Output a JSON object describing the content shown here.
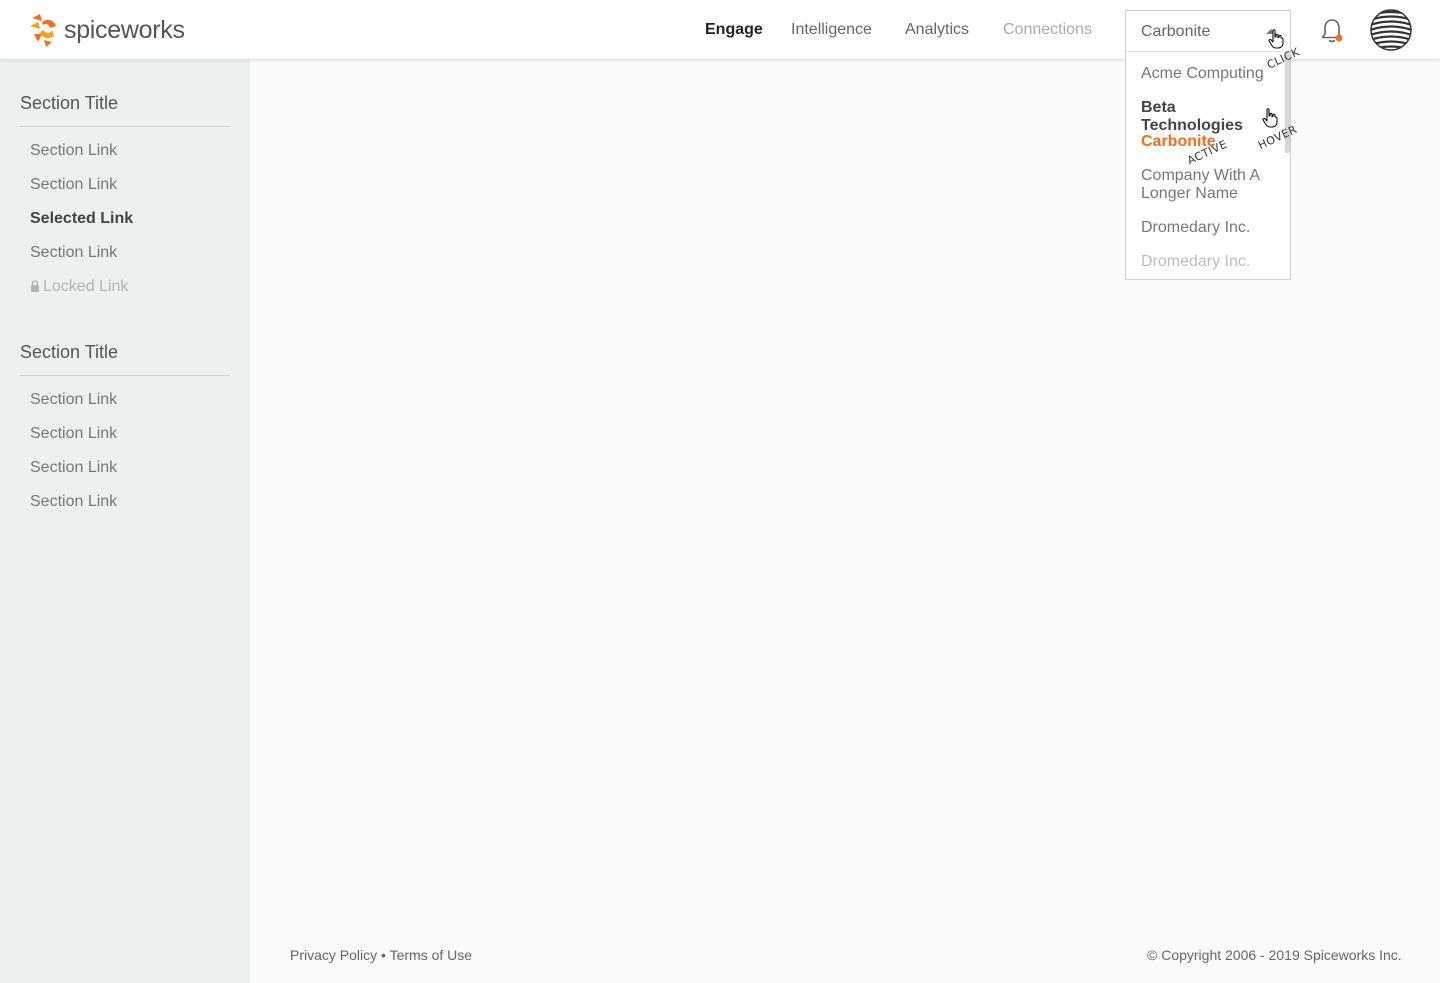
{
  "brand": {
    "name": "spiceworks",
    "logo_colors": [
      "#f26f21",
      "#f9a11b"
    ]
  },
  "nav": {
    "items": [
      {
        "label": "Engage",
        "state": "active"
      },
      {
        "label": "Intelligence",
        "state": "default"
      },
      {
        "label": "Analytics",
        "state": "default"
      },
      {
        "label": "Connections",
        "state": "disabled"
      }
    ]
  },
  "selector": {
    "selected_value": "Carbonite",
    "options": [
      {
        "label": "Acme Computing",
        "state": "default"
      },
      {
        "label": "Beta Technologies",
        "state": "hover"
      },
      {
        "label": "Carbonite",
        "state": "active"
      },
      {
        "label": "Company With A Longer Name",
        "state": "default"
      },
      {
        "label": "Dromedary Inc.",
        "state": "default"
      },
      {
        "label": "Dromedary Inc.",
        "state": "faded"
      }
    ],
    "annotations": {
      "click": "CLICK",
      "hover": "HOVER",
      "active": "ACTIVE"
    }
  },
  "header_icons": {
    "bell": "bell-icon",
    "avatar": "avatar-icon",
    "notification_dot_color": "#f26f21"
  },
  "sidebar": {
    "sections": [
      {
        "title": "Section Title",
        "links": [
          {
            "label": "Section Link",
            "state": "default"
          },
          {
            "label": "Section Link",
            "state": "default"
          },
          {
            "label": "Selected Link",
            "state": "selected"
          },
          {
            "label": "Section Link",
            "state": "default"
          },
          {
            "label": "Locked Link",
            "state": "locked"
          }
        ]
      },
      {
        "title": "Section Title",
        "links": [
          {
            "label": "Section Link",
            "state": "default"
          },
          {
            "label": "Section Link",
            "state": "default"
          },
          {
            "label": "Section Link",
            "state": "default"
          },
          {
            "label": "Section Link",
            "state": "default"
          }
        ]
      }
    ]
  },
  "footer": {
    "privacy": "Privacy Policy",
    "separator": "•",
    "terms": "Terms of Use",
    "copyright": "© Copyright 2006 - 2019 Spiceworks Inc."
  },
  "colors": {
    "accent": "#f26f21",
    "sidebar_bg": "#edf0f1",
    "page_bg": "#fafafa"
  }
}
